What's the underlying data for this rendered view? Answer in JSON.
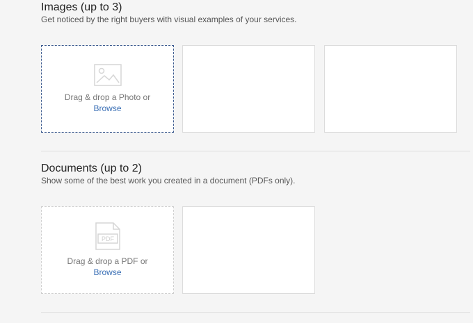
{
  "images": {
    "title": "Images (up to 3)",
    "description": "Get noticed by the right buyers with visual examples of your services.",
    "drop_text": "Drag & drop a Photo or",
    "browse_label": "Browse",
    "icon": "image-icon"
  },
  "documents": {
    "title": "Documents (up to 2)",
    "description": "Show some of the best work you created in a document (PDFs only).",
    "drop_text": "Drag & drop a PDF or",
    "browse_label": "Browse",
    "icon": "pdf-file-icon",
    "icon_text": "PDF"
  },
  "colors": {
    "link": "#3a6fb5",
    "active_border": "#3d5b8f"
  }
}
